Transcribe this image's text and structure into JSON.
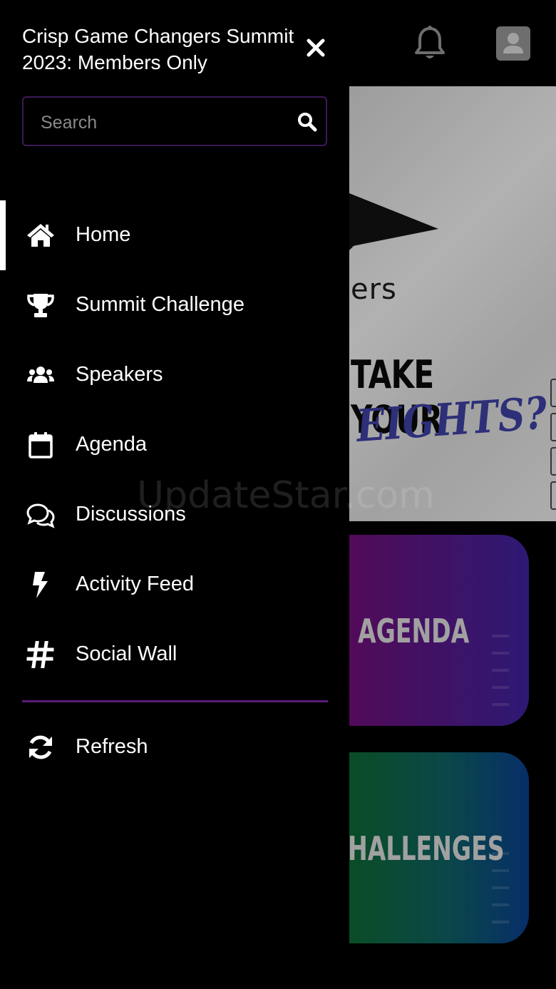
{
  "drawer": {
    "app_title": "Crisp Game Changers Summit 2023: Members Only",
    "search_placeholder": "Search",
    "nav_items": [
      {
        "label": "Home",
        "icon": "home-icon",
        "active": true
      },
      {
        "label": "Summit Challenge",
        "icon": "trophy-icon",
        "active": false
      },
      {
        "label": "Speakers",
        "icon": "users-icon",
        "active": false
      },
      {
        "label": "Agenda",
        "icon": "calendar-icon",
        "active": false
      },
      {
        "label": "Discussions",
        "icon": "chat-icon",
        "active": false
      },
      {
        "label": "Activity Feed",
        "icon": "bolt-icon",
        "active": false
      },
      {
        "label": "Social Wall",
        "icon": "hashtag-icon",
        "active": false
      }
    ],
    "refresh_label": "Refresh"
  },
  "header": {
    "notification_icon": "bell-icon",
    "avatar_icon": "user-avatar-icon"
  },
  "background": {
    "hero_text_1": "ers",
    "hero_text_2": "TAKE YOUR",
    "hero_text_3": "EIGHTS?",
    "card_agenda": "AGENDA",
    "card_challenges": "HALLENGES"
  },
  "watermark": "UpdateStar.com",
  "colors": {
    "drawer_bg": "#000000",
    "accent_purple": "#5a1d7a",
    "active_indicator": "#ffffff"
  }
}
